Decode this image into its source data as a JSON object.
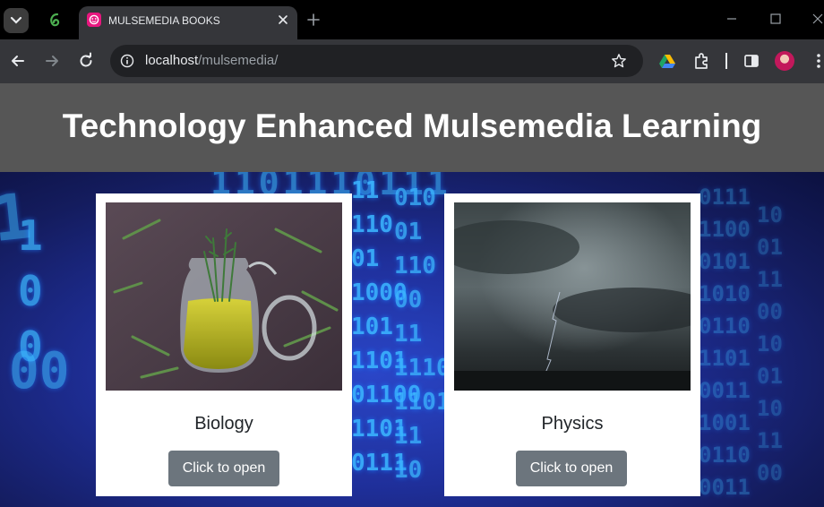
{
  "browser": {
    "tab": {
      "title": "MULSEMEDIA BOOKS"
    },
    "address": {
      "host": "localhost",
      "path": "/mulsemedia/"
    },
    "icons": [
      "tab-search-icon",
      "pinned-tab-icon",
      "close-icon",
      "new-tab-icon",
      "minimize-icon",
      "maximize-icon",
      "window-close-icon",
      "back-icon",
      "forward-icon",
      "reload-icon",
      "site-info-icon",
      "bookmark-star-icon",
      "google-drive-icon",
      "extensions-icon",
      "side-panel-icon",
      "profile-avatar",
      "menu-icon"
    ]
  },
  "page": {
    "title": "Technology Enhanced Mulsemedia Learning",
    "colors": {
      "header_bg": "#565656",
      "button_bg": "#6c757d",
      "accent_binary": "#3ab3ff"
    },
    "cards": [
      {
        "label": "Biology",
        "button": "Click to open",
        "image": "rosemary oil jar"
      },
      {
        "label": "Physics",
        "button": "Click to open",
        "image": "storm clouds with lightning"
      }
    ]
  }
}
